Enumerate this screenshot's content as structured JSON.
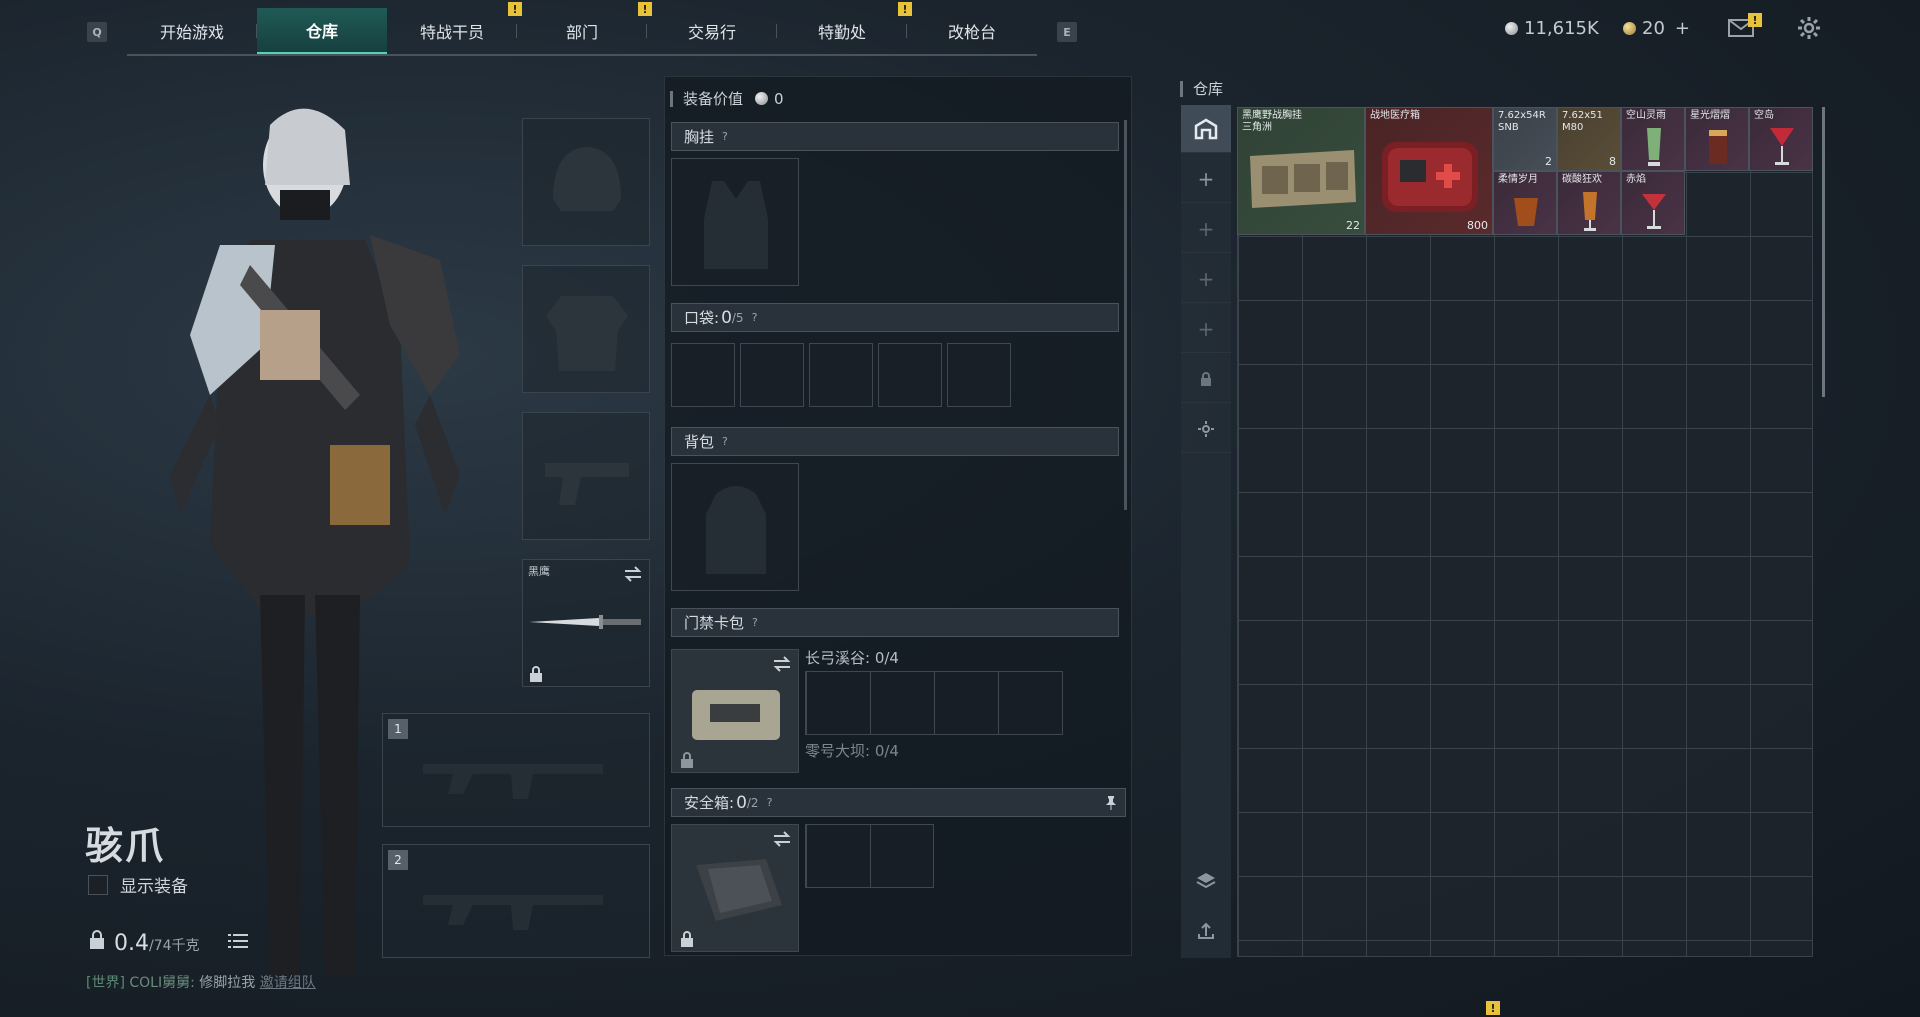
{
  "nav": {
    "left_key": "Q",
    "right_key": "E",
    "tabs": [
      {
        "label": "开始游戏",
        "badge": ""
      },
      {
        "label": "仓库",
        "badge": ""
      },
      {
        "label": "特战干员",
        "badge": "!"
      },
      {
        "label": "部门",
        "badge": "!"
      },
      {
        "label": "交易行",
        "badge": ""
      },
      {
        "label": "特勤处",
        "badge": "!"
      },
      {
        "label": "改枪台",
        "badge": ""
      }
    ],
    "active_tab": "仓库"
  },
  "currency": {
    "silver": "11,615K",
    "gold": "20",
    "gold_add": "+",
    "mail_badge": "!"
  },
  "character": {
    "name": "骇爪",
    "show_equip_label": "显示装备",
    "weight_value": "0.4",
    "weight_max": "/74千克"
  },
  "chat": {
    "channel": "[世界]",
    "user": "COLI舅舅:",
    "message": "修脚拉我",
    "action": "邀请组队"
  },
  "slots": {
    "melee_label": "黑鹰",
    "primary_1": "1",
    "primary_2": "2"
  },
  "equip": {
    "title": "装备价值",
    "value": "0",
    "chest_rig": "胸挂",
    "pockets": "口袋:",
    "pockets_count": "0",
    "pockets_max": "/5",
    "backpack": "背包",
    "keycard": "门禁卡包",
    "key_area_1": "长弓溪谷: 0/4",
    "key_area_2": "零号大坝: 0/4",
    "safebox": "安全箱:",
    "safebox_count": "0",
    "safebox_max": "/2",
    "help": "?"
  },
  "warehouse": {
    "title": "仓库",
    "items": [
      {
        "name": "黑鹰野战胸挂",
        "sub": "三角洲",
        "qty": "22",
        "color": "green"
      },
      {
        "name": "战地医疗箱",
        "sub": "",
        "qty": "800",
        "color": "red"
      },
      {
        "name": "7.62x54R SNB",
        "sub": "",
        "qty": "2",
        "color": "gray"
      },
      {
        "name": "7.62x51 M80",
        "sub": "",
        "qty": "8",
        "color": "tan"
      },
      {
        "name": "空山灵雨",
        "sub": "",
        "qty": "",
        "color": "purple"
      },
      {
        "name": "星光熠熠",
        "sub": "",
        "qty": "",
        "color": "purple"
      },
      {
        "name": "空岛",
        "sub": "",
        "qty": "",
        "color": "purple"
      },
      {
        "name": "柔情岁月",
        "sub": "",
        "qty": "",
        "color": "purple"
      },
      {
        "name": "碳酸狂欢",
        "sub": "",
        "qty": "",
        "color": "purple"
      },
      {
        "name": "赤焰",
        "sub": "",
        "qty": "",
        "color": "purple"
      }
    ]
  }
}
